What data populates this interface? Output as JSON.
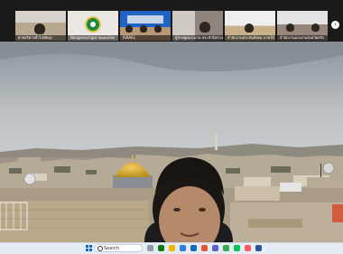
{
  "gallery": {
    "tiles": [
      {
        "name": "ฝ่ายบริหารทั่วไปพัทลุง"
      },
      {
        "name": "Nongnooch@ชายแดนไทย"
      },
      {
        "name": "ISRAEL"
      },
      {
        "name": "ผู้ช่วยทูตแรงงาน ประจำอิสราเอล"
      },
      {
        "name": "สำนักงานประกันสังคม ภาคใต้"
      },
      {
        "name": "สำนักงานแรงงานจังหวัดตรัง"
      }
    ],
    "next_icon": "chevron-right-icon",
    "next_glyph": "›"
  },
  "main_video": {
    "scene": "jerusalem-old-city-with-dome-of-the-rock",
    "speaker": "man-in-foreground"
  },
  "taskbar": {
    "search_placeholder": "Search",
    "apps": [
      "file-explorer-icon",
      "browser-icon",
      "store-icon",
      "mail-icon",
      "teams-icon",
      "chrome-icon",
      "folder-icon",
      "security-icon",
      "settings-icon",
      "line-icon",
      "app-icon",
      "word-icon"
    ],
    "colors": {
      "accent": "#0a64c9"
    }
  }
}
